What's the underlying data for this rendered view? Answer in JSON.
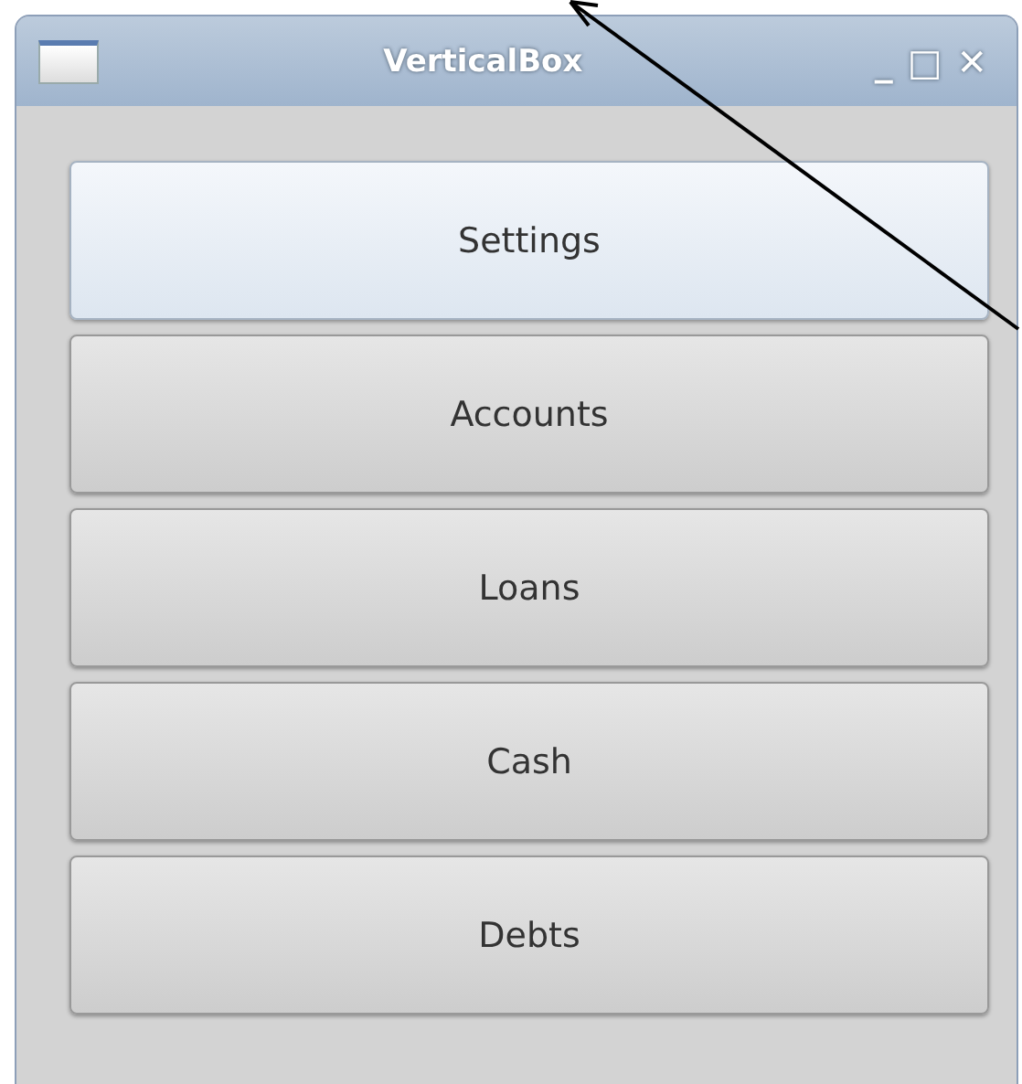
{
  "window": {
    "title": "VerticalBox",
    "controls": [
      "_",
      "□",
      "✕"
    ]
  },
  "buttons": [
    {
      "label": "Settings",
      "highlighted": true
    },
    {
      "label": "Accounts",
      "highlighted": false
    },
    {
      "label": "Loans",
      "highlighted": false
    },
    {
      "label": "Cash",
      "highlighted": false
    },
    {
      "label": "Debts",
      "highlighted": false
    }
  ]
}
